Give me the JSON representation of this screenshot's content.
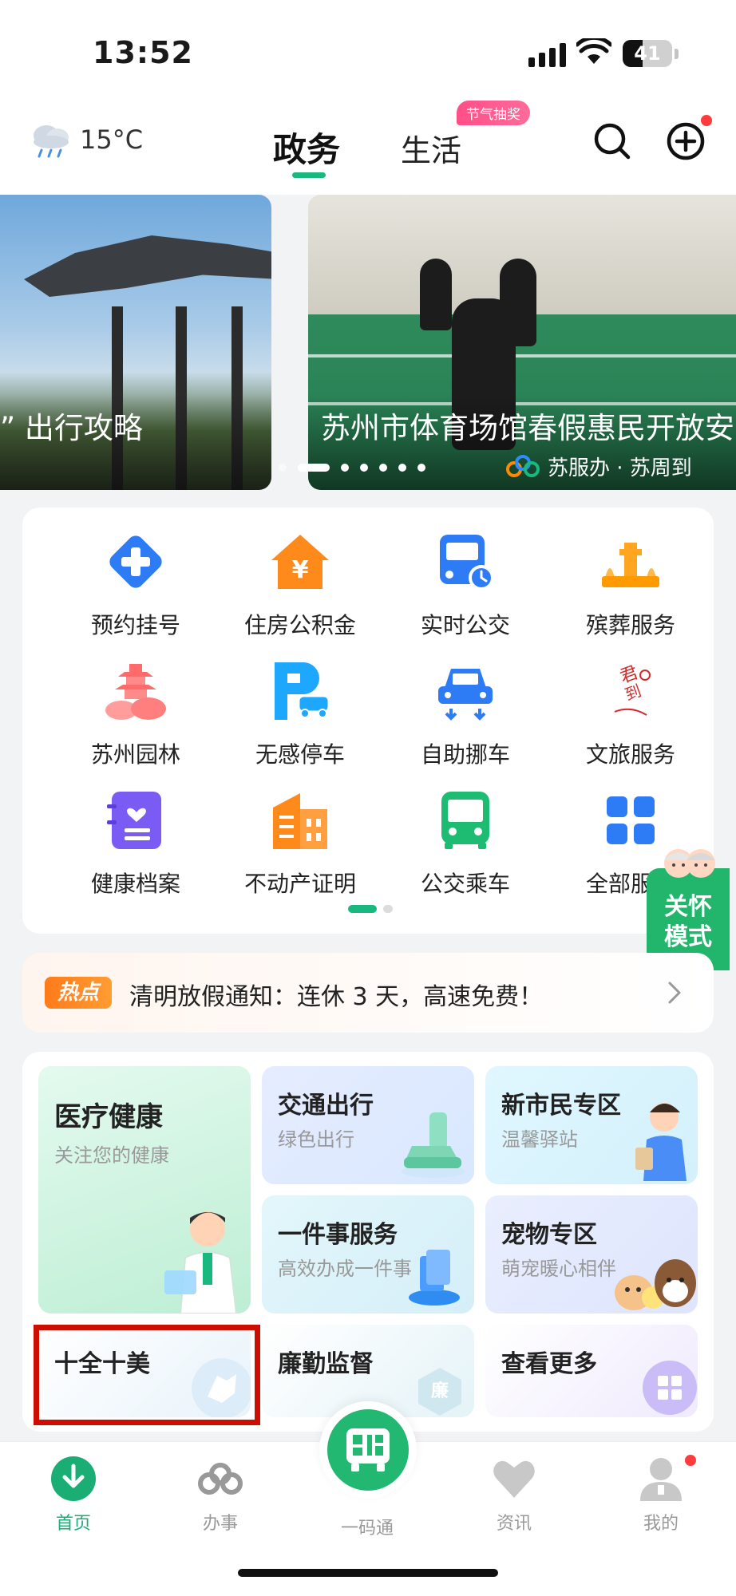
{
  "status_bar": {
    "time": "13:52",
    "battery": "41",
    "battery_level": 0.41
  },
  "header": {
    "temperature": "15°C",
    "weather_icon": "rain-cloud-icon",
    "tabs": [
      {
        "label": "政务",
        "active": true
      },
      {
        "label": "生活",
        "active": false
      }
    ],
    "promo_badge": "节气抽奖"
  },
  "banner": {
    "slides": [
      {
        "caption": "” 出行攻略"
      },
      {
        "caption": "苏州市体育场馆春假惠民开放安"
      }
    ],
    "brand": "苏服办 · 苏周到",
    "active_slide": 2,
    "total_slides": 7
  },
  "services": {
    "items": [
      {
        "label": "预约挂号",
        "icon": "hospital-cross-icon"
      },
      {
        "label": "住房公积金",
        "icon": "house-yuan-icon"
      },
      {
        "label": "实时公交",
        "icon": "bus-clock-icon"
      },
      {
        "label": "殡葬服务",
        "icon": "memorial-icon"
      },
      {
        "label": "苏州园林",
        "icon": "pagoda-icon"
      },
      {
        "label": "无感停车",
        "icon": "parking-icon"
      },
      {
        "label": "自助挪车",
        "icon": "car-move-icon"
      },
      {
        "label": "文旅服务",
        "icon": "culture-travel-icon"
      },
      {
        "label": "健康档案",
        "icon": "health-record-icon"
      },
      {
        "label": "不动产证明",
        "icon": "building-icon"
      },
      {
        "label": "公交乘车",
        "icon": "bus-ride-icon"
      },
      {
        "label": "全部服务",
        "icon": "grid-icon"
      }
    ],
    "page": 1,
    "pages": 2
  },
  "care_mode": {
    "line1": "关怀",
    "line2": "模式"
  },
  "notice": {
    "tag": "热点",
    "text": "清明放假通知：连休 3 天，高速免费！"
  },
  "topics": {
    "medical": {
      "title": "医疗健康",
      "subtitle": "关注您的健康"
    },
    "traffic": {
      "title": "交通出行",
      "subtitle": "绿色出行"
    },
    "new_citizen": {
      "title": "新市民专区",
      "subtitle": "温馨驿站"
    },
    "one_thing": {
      "title": "一件事服务",
      "subtitle": "高效办成一件事"
    },
    "pets": {
      "title": "宠物专区",
      "subtitle": "萌宠暖心相伴"
    },
    "ten_beauty": {
      "title": "十全十美"
    },
    "integrity": {
      "title": "廉勤监督",
      "badge": "廉"
    },
    "more": {
      "title": "查看更多"
    }
  },
  "tabbar": {
    "items": [
      {
        "label": "首页",
        "icon": "home-download-icon",
        "active": true
      },
      {
        "label": "办事",
        "icon": "service-logo-icon",
        "active": false
      },
      {
        "label": "一码通",
        "icon": "qr-bus-icon",
        "active": false
      },
      {
        "label": "资讯",
        "icon": "heart-icon",
        "active": false
      },
      {
        "label": "我的",
        "icon": "user-icon",
        "active": false
      }
    ]
  },
  "colors": {
    "brand_green": "#19b87f",
    "promo_pink": "#ff4f87",
    "hot_orange": "#ff7a1a",
    "focus_red": "#cc0f00"
  }
}
